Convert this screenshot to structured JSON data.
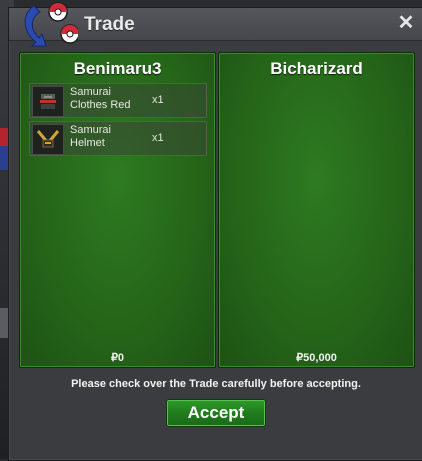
{
  "window": {
    "title": "Trade",
    "close_icon": "close-icon"
  },
  "left_panel": {
    "player_name": "Benimaru3",
    "items": [
      {
        "name": "Samurai Clothes Red",
        "line1": "Samurai",
        "line2": "Clothes Red",
        "quantity": "x1",
        "icon": "clothes-icon"
      },
      {
        "name": "Samurai Helmet",
        "line1": "Samurai",
        "line2": "Helmet",
        "quantity": "x1",
        "icon": "helmet-icon"
      }
    ],
    "money": "₽0"
  },
  "right_panel": {
    "player_name": "Bicharizard",
    "items": [],
    "money": "₽50,000"
  },
  "notice": "Please check over the Trade carefully before accepting.",
  "accept_label": "Accept",
  "colors": {
    "panel_green": "#246418",
    "accept_green": "#1f7a1c",
    "window_bg": "#3b3c40"
  }
}
